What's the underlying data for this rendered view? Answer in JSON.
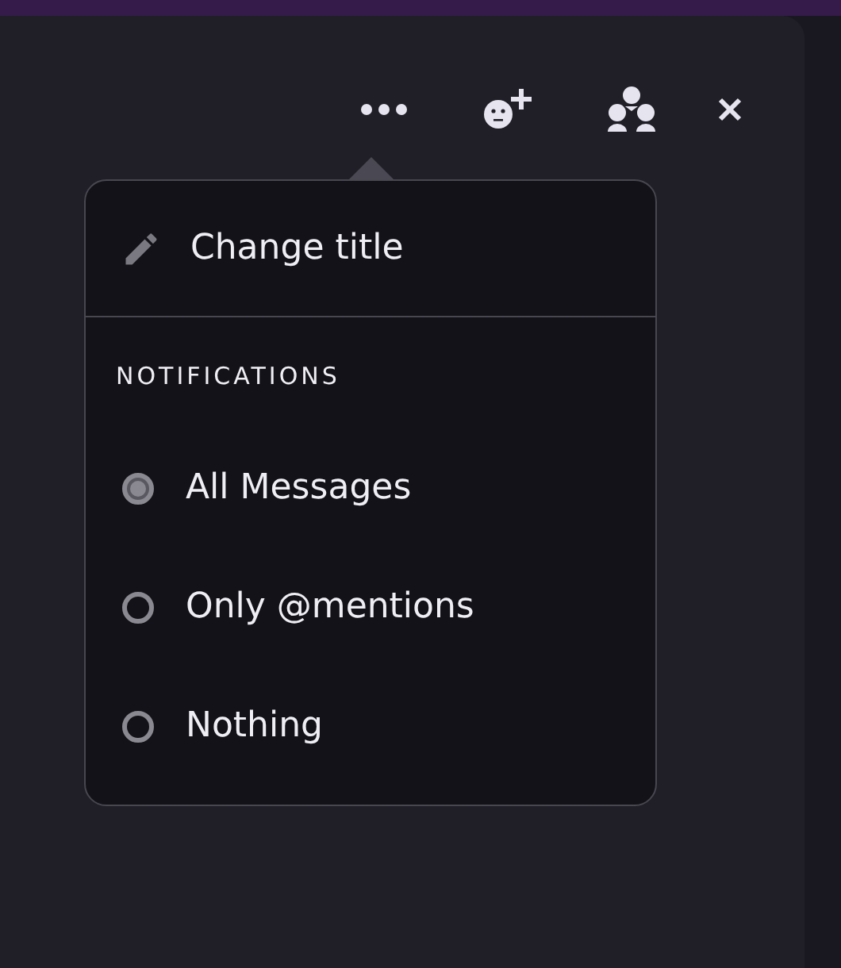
{
  "toolbar": {
    "buttons": [
      {
        "kind": "more"
      },
      {
        "kind": "add-person"
      },
      {
        "kind": "group"
      },
      {
        "kind": "close"
      }
    ]
  },
  "menu": {
    "items": [
      {
        "label": "Change title"
      }
    ],
    "section": "NOTIFICATIONS",
    "options": [
      {
        "label": "All Messages",
        "selected": true
      },
      {
        "label": "Only @mentions",
        "selected": false
      },
      {
        "label": "Nothing",
        "selected": false
      }
    ]
  }
}
